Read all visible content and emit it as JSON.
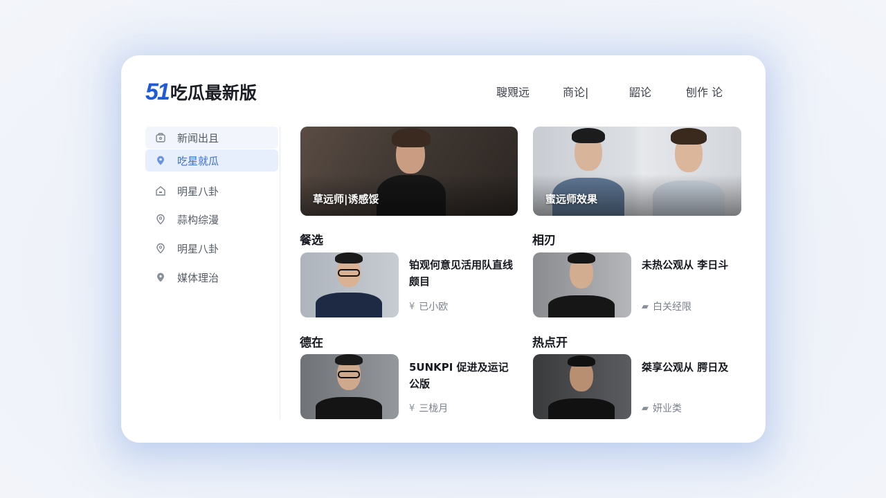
{
  "logo": {
    "number": "51",
    "text": "吃瓜最新版"
  },
  "topnav": [
    "䏂覭远",
    "商论|",
    "鼦论",
    "刨作 论"
  ],
  "sidebar": {
    "items": [
      {
        "label": "新闻出且",
        "icon": "bag-icon"
      },
      {
        "label": "吃星就瓜",
        "icon": "location-pin-icon",
        "active": true
      },
      {
        "label": "明星八卦",
        "icon": "home-icon"
      },
      {
        "label": "蒜构综漫",
        "icon": "location-pin-icon"
      },
      {
        "label": "明星八卦",
        "icon": "location-pin-icon"
      },
      {
        "label": "媒体理治",
        "icon": "location-pin-icon"
      }
    ]
  },
  "banners": [
    {
      "caption": "草远师|诱感馁"
    },
    {
      "caption": "蜜远师效果"
    }
  ],
  "sections": [
    {
      "title": "餐选",
      "card": {
        "title": "铂观何意见活用队直线颇目",
        "meta_icon": "¥",
        "meta": "已小欧"
      }
    },
    {
      "title": "相刃",
      "card": {
        "title": "未热公观从 李日斗",
        "meta_icon": "▰",
        "meta": "白关经限"
      }
    },
    {
      "title": "德在",
      "card": {
        "title": "5UNKPI 促进及运记公版",
        "meta_icon": "¥",
        "meta": "三栊月"
      }
    },
    {
      "title": "热点开",
      "card": {
        "title": "桀享公观从 腭日及",
        "meta_icon": "▰",
        "meta": "妍业类"
      }
    }
  ],
  "colors": {
    "accent": "#1f5bd6",
    "active_bg": "#e7effc",
    "active_text": "#3a6fd8"
  }
}
